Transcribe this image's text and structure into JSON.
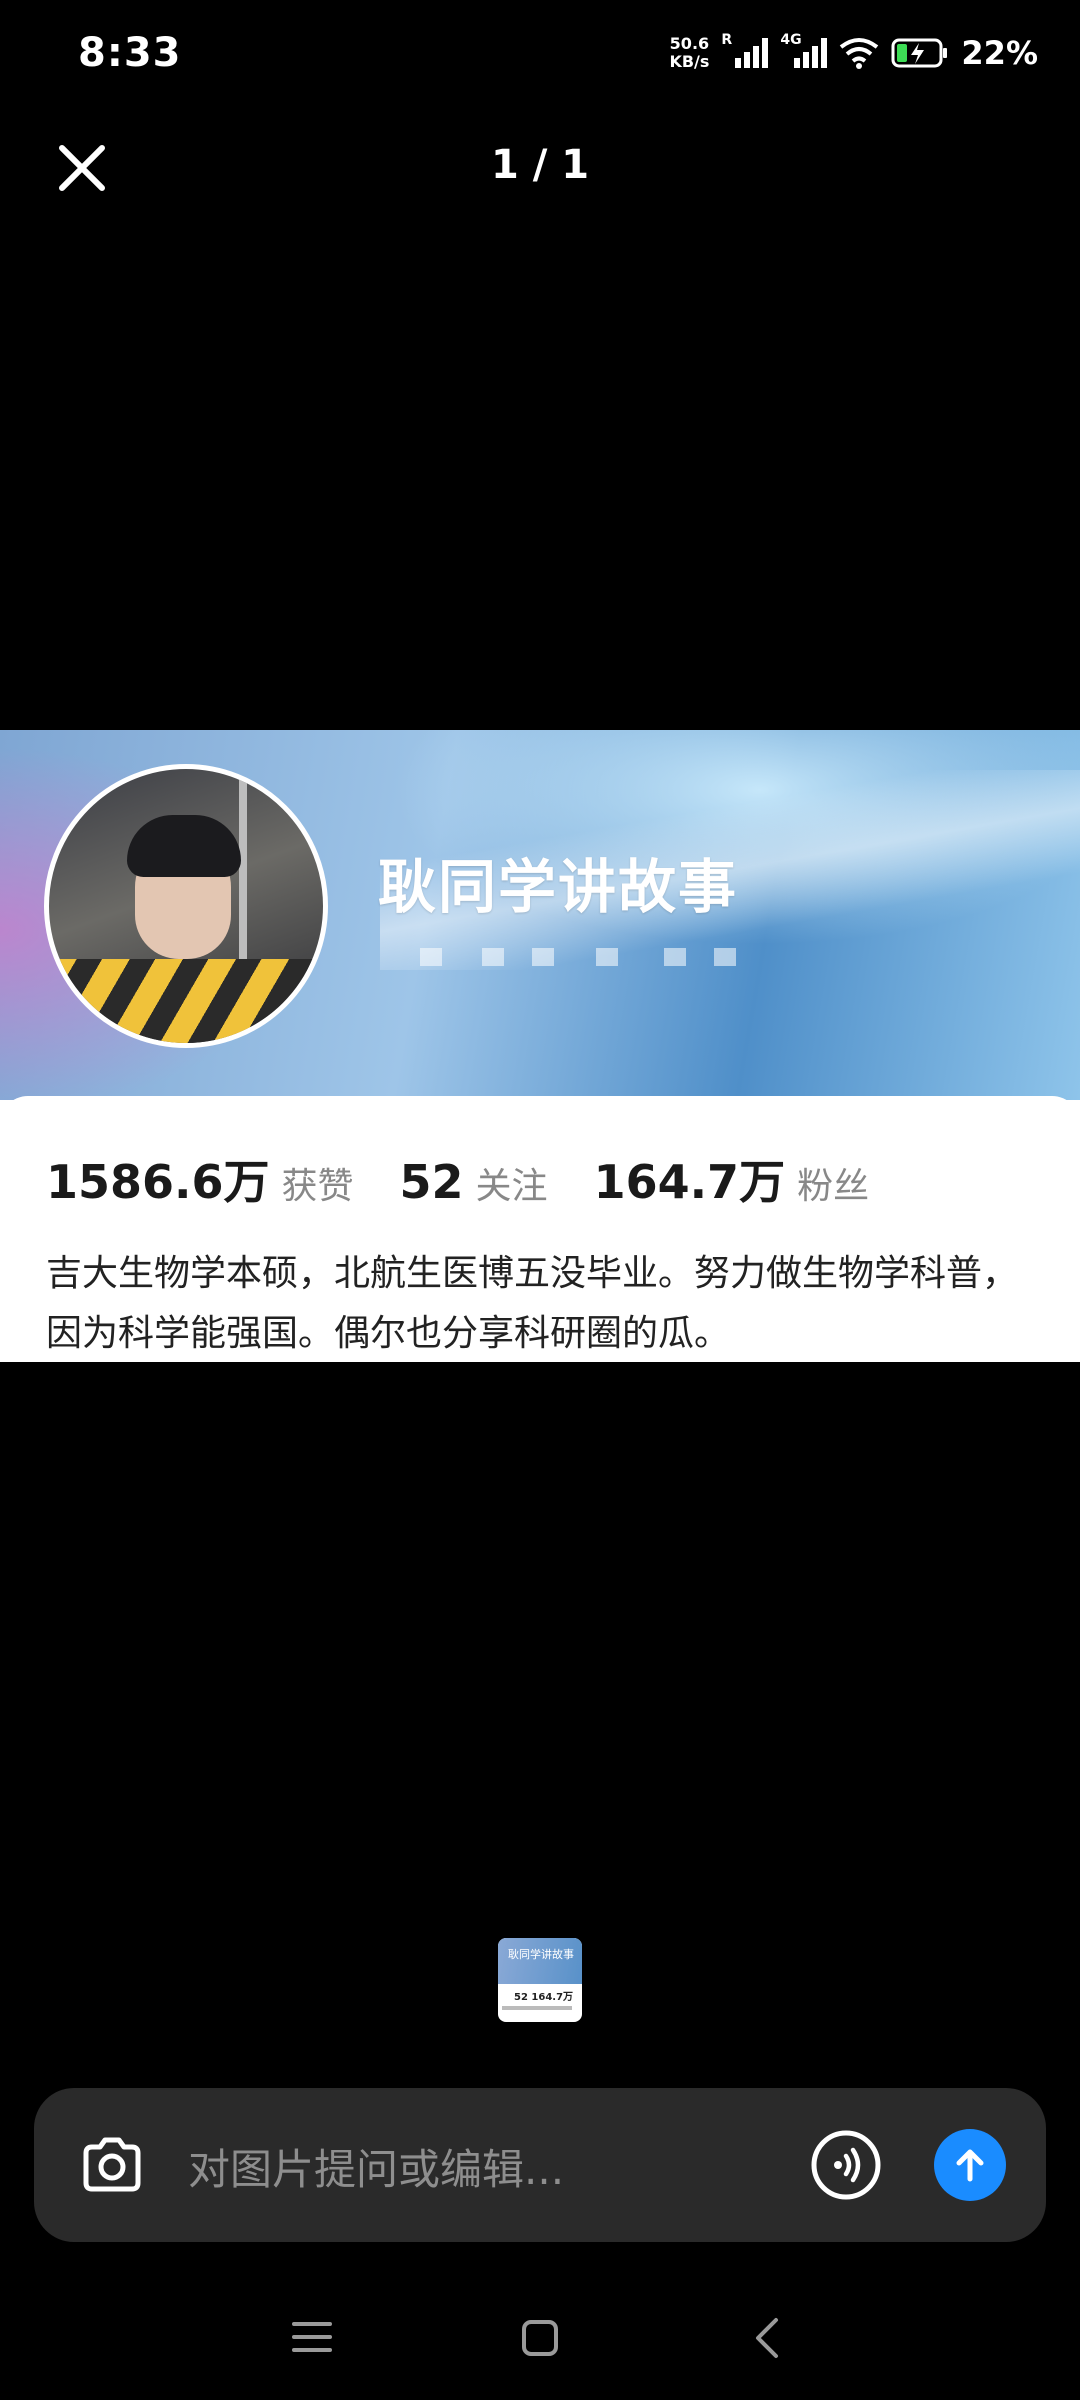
{
  "status_bar": {
    "time": "8:33",
    "net_speed_value": "50.6",
    "net_speed_unit": "KB/s",
    "sim1_label": "R",
    "sim2_label": "4G",
    "battery_percent": "22%",
    "icons": [
      "signal-icon",
      "signal-icon",
      "wifi-icon",
      "battery-charging-icon"
    ]
  },
  "viewer": {
    "page_counter": "1 / 1",
    "close_icon": "close-icon"
  },
  "image": {
    "profile_name": "耿同学讲故事",
    "stats": [
      {
        "value": "1586.6万",
        "label": "获赞"
      },
      {
        "value": "52",
        "label": "关注"
      },
      {
        "value": "164.7万",
        "label": "粉丝"
      }
    ],
    "bio": "吉大生物学本硕，北航生医博五没毕业。努力做生物学科普，因为科学能强国。偶尔也分享科研圈的瓜。"
  },
  "thumbnail": {
    "title": "耿同学讲故事",
    "stats_text": "52  164.7万"
  },
  "input_bar": {
    "placeholder": "对图片提问或编辑...",
    "camera_icon": "camera-icon",
    "voice_icon": "voice-call-icon",
    "send_icon": "send-arrow-up-icon",
    "accent_color": "#1a8cff"
  },
  "nav_bar": {
    "icons": [
      "menu-icon",
      "home-square-icon",
      "back-chevron-icon"
    ]
  }
}
